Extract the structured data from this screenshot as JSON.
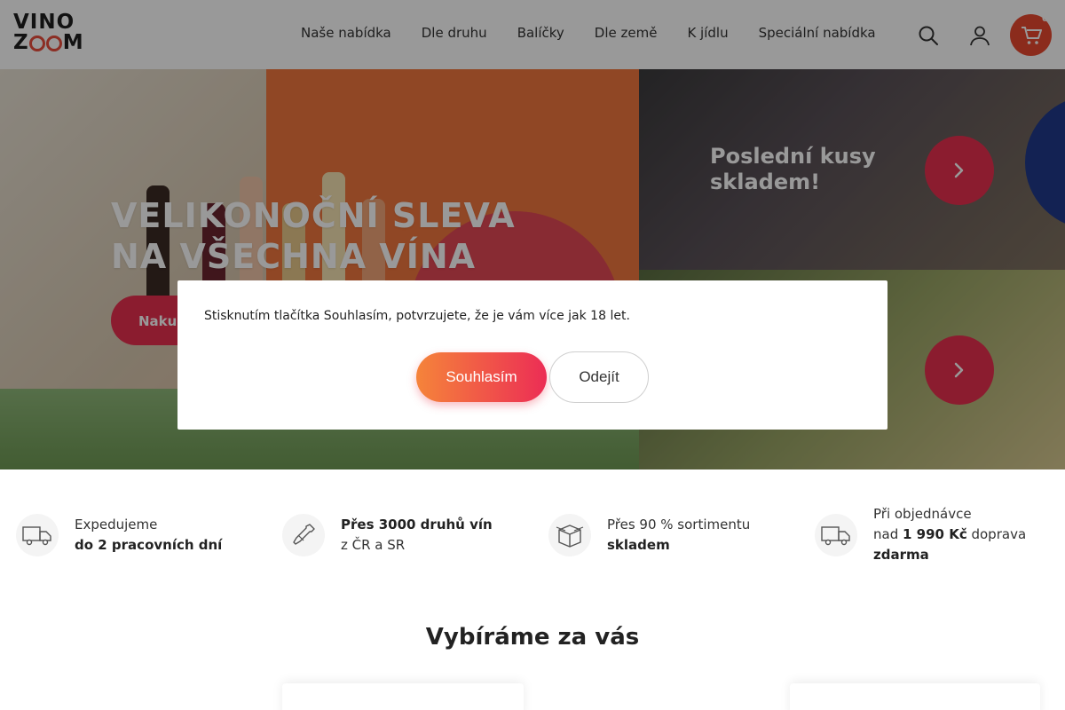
{
  "header": {
    "logo_line1": "VINO",
    "logo_line2_a": "Z",
    "logo_line2_b": "M",
    "nav": [
      "Naše nabídka",
      "Dle druhu",
      "Balíčky",
      "Dle země",
      "K jídlu",
      "Speciální nabídka"
    ],
    "cart_count": "0",
    "icons": {
      "search": "search-icon",
      "user": "user-icon",
      "cart": "cart-icon"
    }
  },
  "hero": {
    "title_line1": "VELIKONOČNÍ SLEVA",
    "title_line2": "NA VŠECHNA VÍNA",
    "cta": "Nakupovat",
    "tile_top_title": "Poslední kusy skladem!"
  },
  "modal": {
    "text": "Stisknutím tlačítka Souhlasím, potvrzujete, že je vám více jak 18 let.",
    "agree": "Souhlasím",
    "leave": "Odejít"
  },
  "features": [
    {
      "line1": "Expedujeme",
      "line2": "do 2 pracovních dní",
      "icon": "truck-icon"
    },
    {
      "line1": "Přes 3000 druhů vín",
      "line2": "z ČR a SR",
      "icon": "bottle-icon"
    },
    {
      "line1": "Přes 90 % sortimentu",
      "line2": "skladem",
      "icon": "box-icon"
    },
    {
      "line1": "Při objednávce",
      "line2a": "nad ",
      "line2b": "1 990 Kč",
      "line2c": " doprava",
      "line3": "zdarma",
      "icon": "truck-icon"
    }
  ],
  "section": {
    "title": "Vybíráme za vás"
  },
  "colors": {
    "accent": "#e8304f",
    "orange": "#f5843a"
  }
}
